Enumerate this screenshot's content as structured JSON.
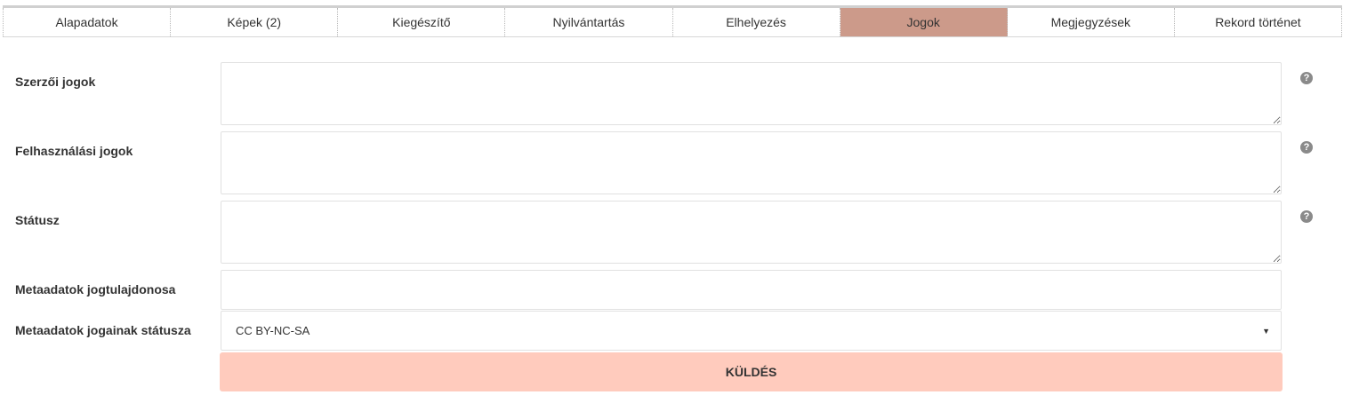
{
  "tabs": [
    {
      "label": "Alapadatok",
      "active": false
    },
    {
      "label": "Képek (2)",
      "active": false
    },
    {
      "label": "Kiegészítő",
      "active": false
    },
    {
      "label": "Nyilvántartás",
      "active": false
    },
    {
      "label": "Elhelyezés",
      "active": false
    },
    {
      "label": "Jogok",
      "active": true
    },
    {
      "label": "Megjegyzések",
      "active": false
    },
    {
      "label": "Rekord történet",
      "active": false
    }
  ],
  "form": {
    "copyright": {
      "label": "Szerzői jogok",
      "value": ""
    },
    "usage_rights": {
      "label": "Felhasználási jogok",
      "value": ""
    },
    "status": {
      "label": "Státusz",
      "value": ""
    },
    "metadata_owner": {
      "label": "Metaadatok jogtulajdonosa",
      "value": ""
    },
    "metadata_rights_status": {
      "label": "Metaadatok jogainak státusza",
      "selected": "CC BY-NC-SA"
    }
  },
  "help_icon_glyph": "?",
  "select_caret": "▼",
  "submit_label": "KÜLDÉS",
  "colors": {
    "active_tab": "#cc9a8a",
    "submit_bg": "#ffcbbd",
    "help_icon": "#8a8a8a"
  }
}
